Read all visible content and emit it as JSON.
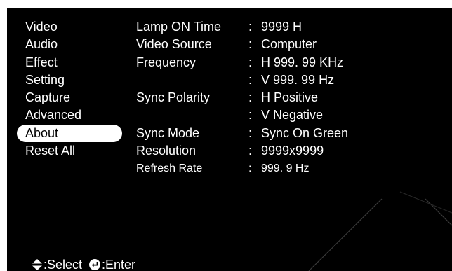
{
  "menu": {
    "items": [
      "Video",
      "Audio",
      "Effect",
      "Setting",
      "Capture",
      "Advanced",
      "About",
      "Reset All"
    ],
    "selected_index": 6
  },
  "info": {
    "separator": ":",
    "rows": [
      {
        "label": "Lamp ON Time",
        "value": "9999 H"
      },
      {
        "label": "Video Source",
        "value": "Computer"
      },
      {
        "label": "Frequency",
        "value": "H 999. 99 KHz"
      },
      {
        "label": "",
        "value": "V 999. 99 Hz"
      },
      {
        "label": "Sync Polarity",
        "value": "H Positive"
      },
      {
        "label": "",
        "value": "V Negative"
      },
      {
        "label": "Sync Mode",
        "value": "Sync On Green"
      },
      {
        "label": "Resolution",
        "value": "9999x9999"
      },
      {
        "label": "Refresh Rate",
        "value": "999. 9 Hz"
      }
    ]
  },
  "footer": {
    "select_icon": "up-down-arrow-icon",
    "select_label": ":Select",
    "enter_icon": "enter-icon",
    "enter_label": ":Enter"
  },
  "colors": {
    "background": "#000000",
    "text": "#ffffff",
    "highlight": "#ffffff",
    "highlight_text": "#000000"
  }
}
